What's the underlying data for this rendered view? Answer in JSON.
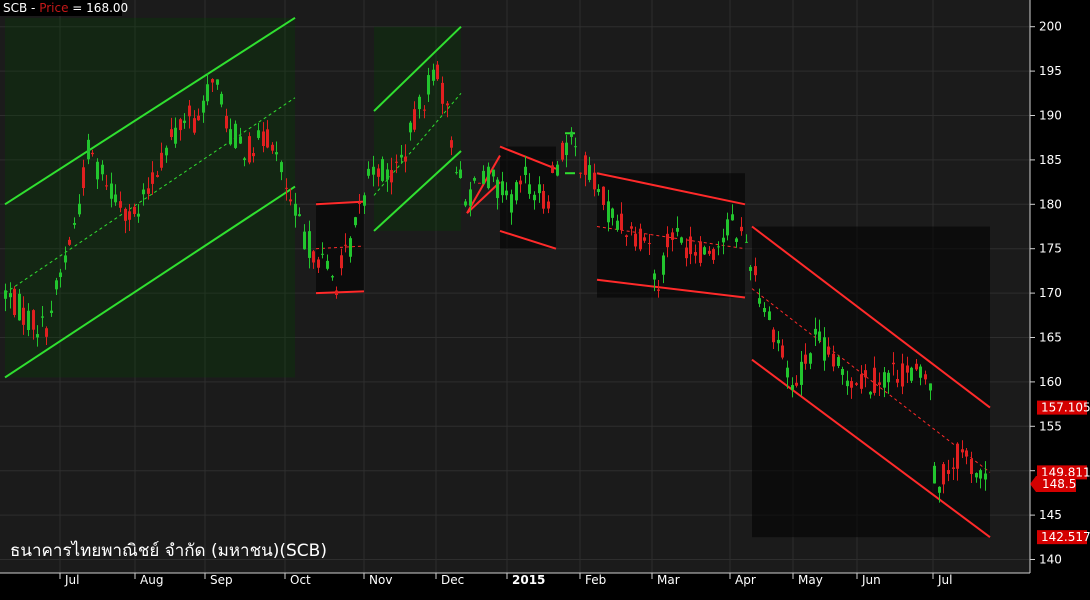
{
  "header": {
    "symbol": "SCB",
    "separator": " - ",
    "indicator": "Price",
    "equals": " = ",
    "value": "168.00"
  },
  "watermark": "ธนาคารไทยพาณิชย์ จำกัด (มหาชน)(SCB)",
  "colors": {
    "background": "#000000",
    "plot_background": "#1b1b1b",
    "grid": "#2e2e2e",
    "up": "#22c52e",
    "down": "#e02020",
    "up_channel": "#30e030",
    "down_channel": "#ff2a2a",
    "axis_text": "#ffffff",
    "price_indicator": "#d40000"
  },
  "price_tags": {
    "upper": "157.105",
    "middle": "149.811",
    "last": "148.5",
    "lower": "142.517"
  },
  "chart_data": {
    "type": "candlestick",
    "title": "SCB - Price = 168.00",
    "ylim": [
      137.5,
      201.5
    ],
    "y_ticks": [
      140,
      145,
      150,
      155,
      160,
      165,
      170,
      175,
      180,
      185,
      190,
      195,
      200
    ],
    "x_ticks": [
      "Jul",
      "Aug",
      "Sep",
      "Oct",
      "Nov",
      "Dec",
      "2015",
      "Feb",
      "Mar",
      "Apr",
      "May",
      "Jun",
      "Jul"
    ],
    "close_path": [
      [
        "Jun 2014",
        170
      ],
      [
        "Jun 2014",
        167
      ],
      [
        "Jun 2014",
        166
      ],
      [
        "Jul 2014",
        172
      ],
      [
        "Jul 2014",
        178
      ],
      [
        "Jul 2014",
        186
      ],
      [
        "Jul 2014",
        183
      ],
      [
        "Aug 2014",
        178
      ],
      [
        "Aug 2014",
        185
      ],
      [
        "Aug 2014",
        190
      ],
      [
        "Aug 2014",
        189
      ],
      [
        "Sep 2014",
        195
      ],
      [
        "Sep 2014",
        188
      ],
      [
        "Sep 2014",
        186
      ],
      [
        "Sep 2014",
        188
      ],
      [
        "Oct 2014",
        180
      ],
      [
        "Oct 2014",
        176
      ],
      [
        "Oct 2014",
        174
      ],
      [
        "Oct 2014",
        171
      ],
      [
        "Oct 2014",
        176
      ],
      [
        "Nov 2014",
        185
      ],
      [
        "Nov 2014",
        183
      ],
      [
        "Nov 2014",
        186
      ],
      [
        "Nov 2014",
        191
      ],
      [
        "Dec 2014",
        196
      ],
      [
        "Dec 2014",
        188
      ],
      [
        "Dec 2014",
        180
      ],
      [
        "Dec 2014",
        184
      ],
      [
        "Dec 2014",
        182
      ],
      [
        "Jan 2015",
        180
      ],
      [
        "Jan 2015",
        183
      ],
      [
        "Jan 2015",
        180
      ],
      [
        "Jan 2015",
        186
      ],
      [
        "Jan 2015",
        187
      ],
      [
        "Feb 2015",
        183
      ],
      [
        "Feb 2015",
        179
      ],
      [
        "Feb 2015",
        177
      ],
      [
        "Feb 2015",
        176
      ],
      [
        "Mar 2015",
        170
      ],
      [
        "Mar 2015",
        177
      ],
      [
        "Mar 2015",
        175
      ],
      [
        "Mar 2015",
        175
      ],
      [
        "Apr 2015",
        178
      ],
      [
        "Apr 2015",
        176
      ],
      [
        "Apr 2015",
        170
      ],
      [
        "Apr 2015",
        164
      ],
      [
        "May 2015",
        159
      ],
      [
        "May 2015",
        165
      ],
      [
        "May 2015",
        161
      ],
      [
        "Jun 2015",
        160
      ],
      [
        "Jun 2015",
        161
      ],
      [
        "Jun 2015",
        161
      ],
      [
        "Jun 2015",
        160
      ],
      [
        "Jul 2015",
        148
      ],
      [
        "Jul 2015",
        152
      ],
      [
        "Jul 2015",
        148.5
      ]
    ],
    "last_price": 148.5,
    "regression_channels": [
      {
        "direction": "up",
        "upper": [
          180,
          201
        ],
        "mid": [
          170,
          192
        ],
        "lower": [
          160.5,
          182
        ]
      },
      {
        "direction": "down",
        "upper": [
          180,
          180.3
        ],
        "mid": [
          175,
          175.3
        ],
        "lower": [
          170,
          170.2
        ]
      },
      {
        "direction": "up",
        "upper": [
          190.5,
          200
        ],
        "mid": [
          181,
          192.5
        ],
        "lower": [
          177,
          186
        ]
      },
      {
        "direction": "down",
        "upper": [
          179,
          185.5
        ],
        "lower": [
          179,
          182.5
        ]
      },
      {
        "direction": "down",
        "upper": [
          186.5,
          184
        ],
        "lower": [
          177,
          175
        ]
      },
      {
        "direction": "up",
        "upper": [
          188,
          188
        ],
        "lower": [
          183.5,
          183.5
        ]
      },
      {
        "direction": "down",
        "upper": [
          183.5,
          180
        ],
        "mid": [
          177.5,
          175
        ],
        "lower": [
          171.5,
          169.5
        ]
      },
      {
        "direction": "down",
        "upper": [
          177.5,
          157.105
        ],
        "mid": [
          170.5,
          149.811
        ],
        "lower": [
          162.5,
          142.517
        ]
      }
    ]
  }
}
